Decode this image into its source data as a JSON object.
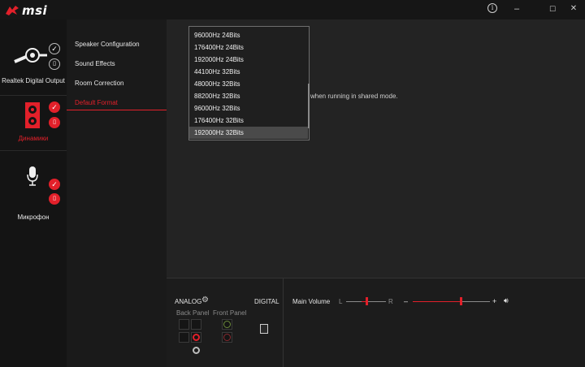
{
  "titlebar": {
    "brand": "msi",
    "info_icon": "info-icon",
    "minimize_glyph": "–",
    "maximize_glyph": "☐",
    "close_glyph": "✕"
  },
  "devices": [
    {
      "label": "Realtek Digital Output",
      "icon": "digital-output-plug-icon",
      "selected": false
    },
    {
      "label": "Динамики",
      "icon": "speaker-icon",
      "selected": true
    },
    {
      "label": "Микрофон",
      "icon": "microphone-icon",
      "selected": false
    }
  ],
  "menu": {
    "items": [
      "Speaker Configuration",
      "Sound Effects",
      "Room Correction",
      "Default Format"
    ],
    "active_index": 3
  },
  "content": {
    "shared_mode_text": "when running in shared mode."
  },
  "format_dropdown": {
    "options": [
      "96000Hz 24Bits",
      "176400Hz 24Bits",
      "192000Hz 24Bits",
      "44100Hz 32Bits",
      "48000Hz 32Bits",
      "88200Hz 32Bits",
      "96000Hz 32Bits",
      "176400Hz 32Bits",
      "192000Hz 32Bits"
    ],
    "selected_index": 8
  },
  "bottom": {
    "analog_label": "ANALOG",
    "digital_label": "DIGITAL",
    "back_panel_label": "Back Panel",
    "front_panel_label": "Front Panel",
    "main_volume_label": "Main Volume",
    "balance_left": "L",
    "balance_right": "R",
    "volume_minus": "–",
    "volume_plus": "+",
    "balance_value": 0.5,
    "volume_value": 0.62
  },
  "colors": {
    "accent": "#e2202a",
    "background": "#1e1e1e"
  }
}
